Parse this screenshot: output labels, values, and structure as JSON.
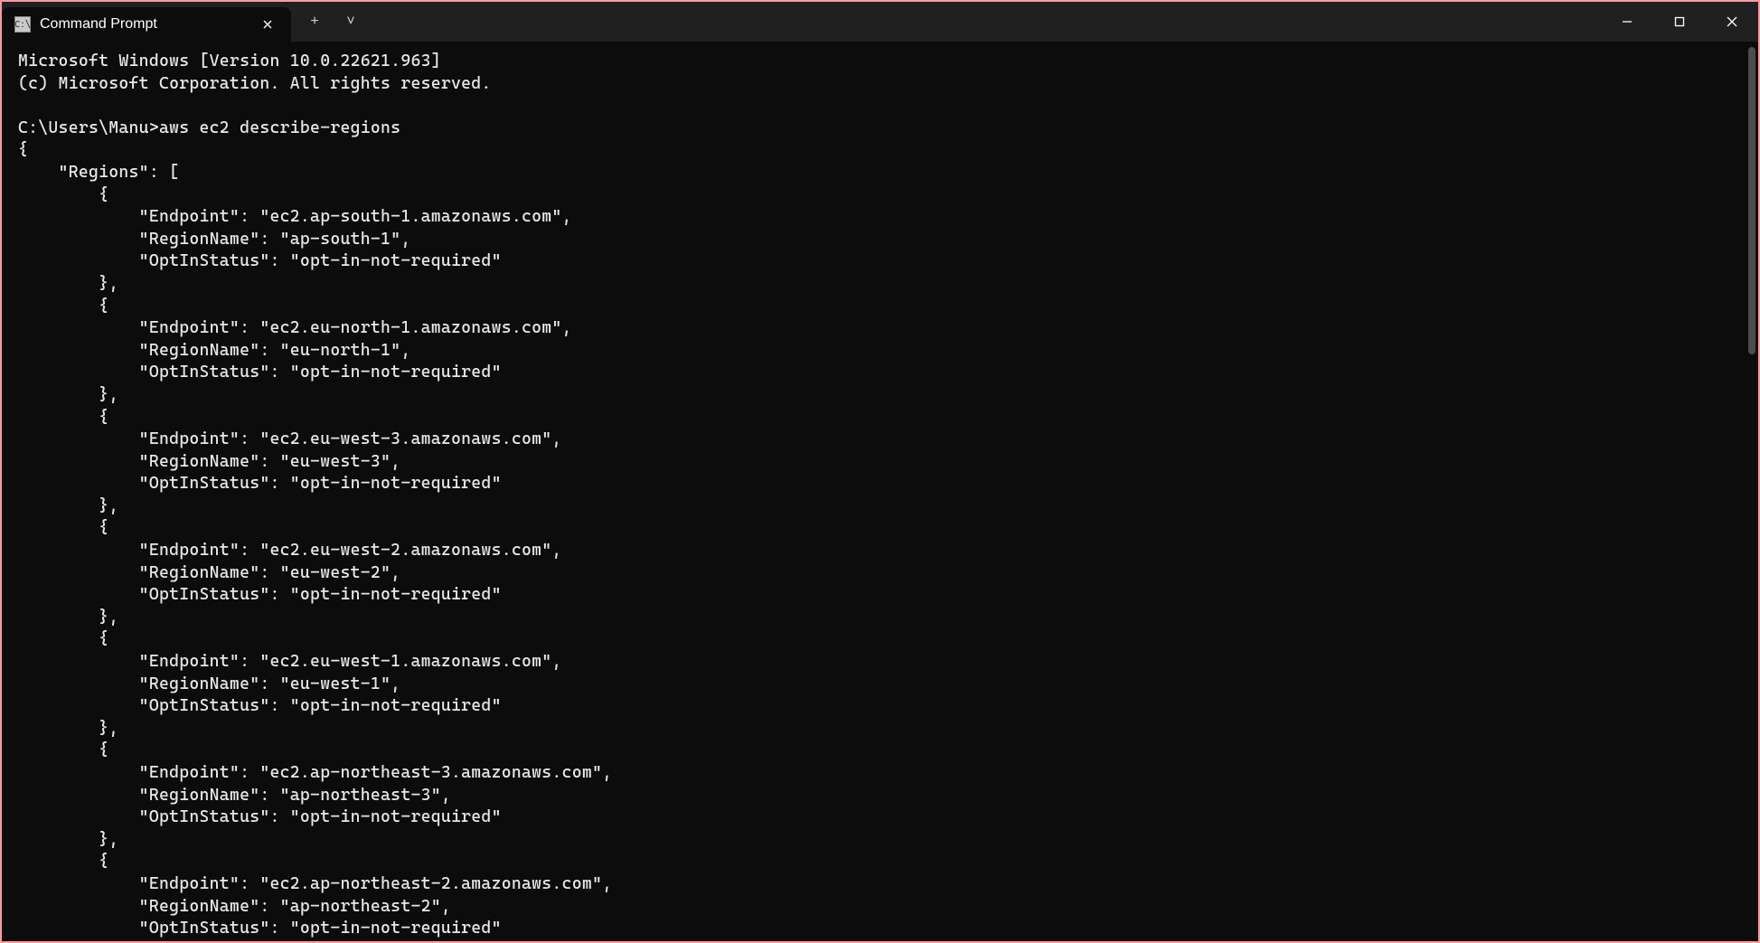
{
  "window": {
    "tab_title": "Command Prompt",
    "new_tab_label": "+",
    "dropdown_label": "˅"
  },
  "terminal": {
    "header_line1": "Microsoft Windows [Version 10.0.22621.963]",
    "header_line2": "(c) Microsoft Corporation. All rights reserved.",
    "prompt": "C:\\Users\\Manu>",
    "command": "aws ec2 describe-regions",
    "json_open": "{",
    "regions_key": "    \"Regions\": [",
    "obj_open": "        {",
    "obj_close_comma": "        },",
    "endpoint_key": "            \"Endpoint\": ",
    "regionname_key": "            \"RegionName\": ",
    "optin_key": "            \"OptInStatus\": ",
    "regions": [
      {
        "endpoint": "\"ec2.ap-south-1.amazonaws.com\",",
        "name": "\"ap-south-1\",",
        "opt": "\"opt-in-not-required\""
      },
      {
        "endpoint": "\"ec2.eu-north-1.amazonaws.com\",",
        "name": "\"eu-north-1\",",
        "opt": "\"opt-in-not-required\""
      },
      {
        "endpoint": "\"ec2.eu-west-3.amazonaws.com\",",
        "name": "\"eu-west-3\",",
        "opt": "\"opt-in-not-required\""
      },
      {
        "endpoint": "\"ec2.eu-west-2.amazonaws.com\",",
        "name": "\"eu-west-2\",",
        "opt": "\"opt-in-not-required\""
      },
      {
        "endpoint": "\"ec2.eu-west-1.amazonaws.com\",",
        "name": "\"eu-west-1\",",
        "opt": "\"opt-in-not-required\""
      },
      {
        "endpoint": "\"ec2.ap-northeast-3.amazonaws.com\",",
        "name": "\"ap-northeast-3\",",
        "opt": "\"opt-in-not-required\""
      },
      {
        "endpoint": "\"ec2.ap-northeast-2.amazonaws.com\",",
        "name": "\"ap-northeast-2\",",
        "opt": "\"opt-in-not-required\""
      }
    ]
  }
}
